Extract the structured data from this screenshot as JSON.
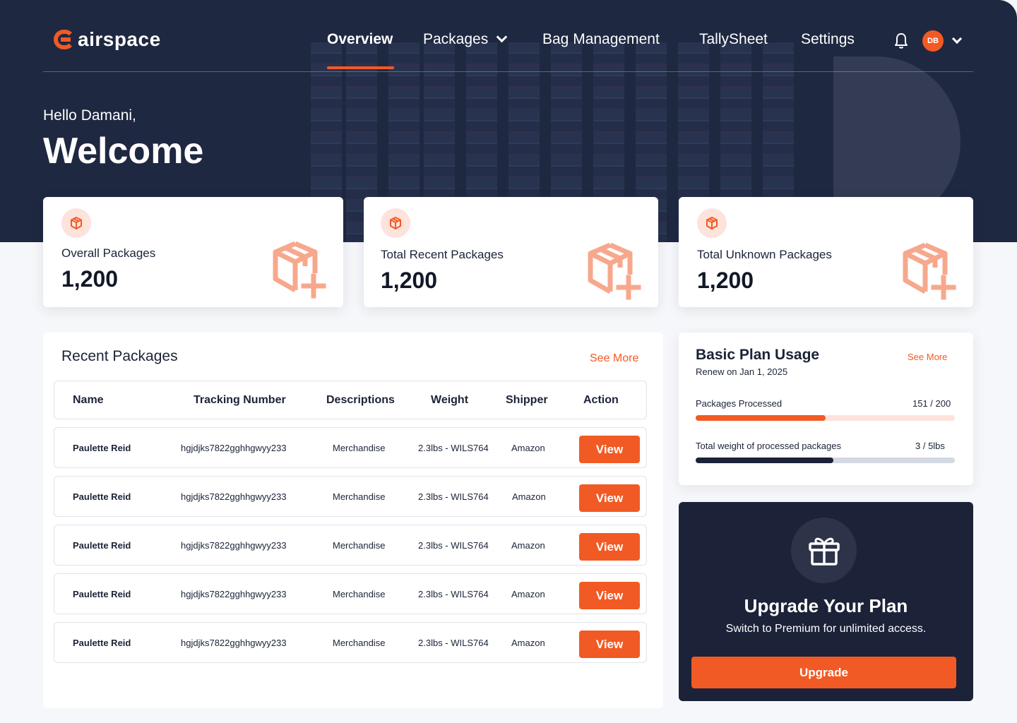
{
  "brand": {
    "name": "airspace",
    "accent": "#f15a24",
    "navy": "#1f2841"
  },
  "nav": {
    "items": [
      {
        "label": "Overview",
        "active": true
      },
      {
        "label": "Packages",
        "active": false,
        "has_dropdown": true
      },
      {
        "label": "Bag Management",
        "active": false
      },
      {
        "label": "TallySheet",
        "active": false
      },
      {
        "label": "Settings",
        "active": false
      }
    ],
    "notification_icon": "bell-icon",
    "user_initials": "DB"
  },
  "hero": {
    "greeting": "Hello Damani,",
    "title": "Welcome"
  },
  "stats": [
    {
      "label": "Overall Packages",
      "value": "1,200",
      "icon": "package-icon"
    },
    {
      "label": "Total Recent Packages",
      "value": "1,200",
      "icon": "package-icon"
    },
    {
      "label": "Total Unknown Packages",
      "value": "1,200",
      "icon": "package-icon"
    }
  ],
  "recent_packages": {
    "title": "Recent Packages",
    "see_more": "See More",
    "columns": [
      "Name",
      "Tracking Number",
      "Descriptions",
      "Weight",
      "Shipper",
      "Action"
    ],
    "rows": [
      {
        "name": "Paulette Reid",
        "tracking": "hgjdjks7822gghhgwyy233",
        "description": "Merchandise",
        "weight": "2.3lbs - WILS764",
        "shipper": "Amazon",
        "action": "View"
      },
      {
        "name": "Paulette Reid",
        "tracking": "hgjdjks7822gghhgwyy233",
        "description": "Merchandise",
        "weight": "2.3lbs - WILS764",
        "shipper": "Amazon",
        "action": "View"
      },
      {
        "name": "Paulette Reid",
        "tracking": "hgjdjks7822gghhgwyy233",
        "description": "Merchandise",
        "weight": "2.3lbs - WILS764",
        "shipper": "Amazon",
        "action": "View"
      },
      {
        "name": "Paulette Reid",
        "tracking": "hgjdjks7822gghhgwyy233",
        "description": "Merchandise",
        "weight": "2.3lbs - WILS764",
        "shipper": "Amazon",
        "action": "View"
      },
      {
        "name": "Paulette Reid",
        "tracking": "hgjdjks7822gghhgwyy233",
        "description": "Merchandise",
        "weight": "2.3lbs - WILS764",
        "shipper": "Amazon",
        "action": "View"
      }
    ]
  },
  "plan": {
    "title": "Basic Plan Usage",
    "see_more": "See More",
    "renew": "Renew on Jan 1, 2025",
    "metrics": [
      {
        "label": "Packages Processed",
        "value": "151 / 200",
        "fraction": 0.5,
        "fill_color": "#f15a24",
        "track_color": "#fde3dc"
      },
      {
        "label": "Total weight of processed packages",
        "value": "3 / 5lbs",
        "fraction": 0.53,
        "fill_color": "#1c2238",
        "track_color": "#d3d9e3"
      }
    ]
  },
  "upgrade": {
    "icon": "gift-icon",
    "title": "Upgrade Your Plan",
    "subtitle": "Switch to Premium for unlimited access.",
    "button": "Upgrade"
  }
}
